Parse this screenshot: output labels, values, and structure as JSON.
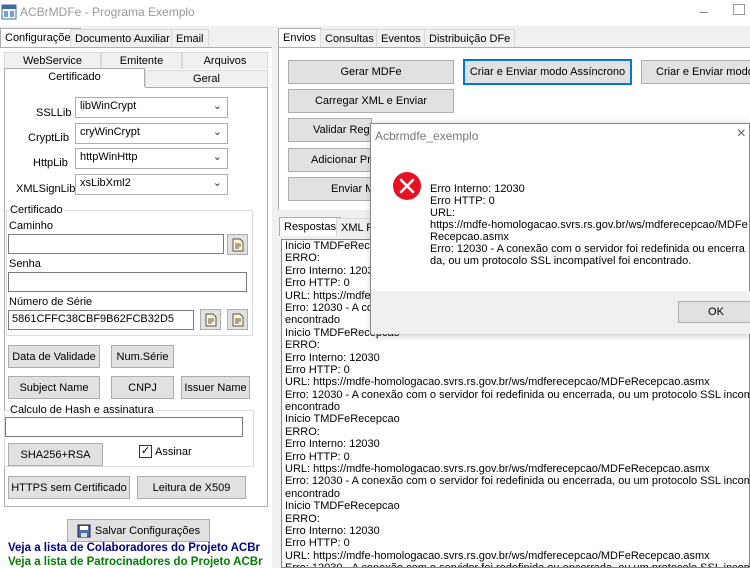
{
  "window": {
    "title": "ACBrMDFe - Programa Exemplo"
  },
  "left_tabs": [
    "Configurações",
    "Documento Auxiliar",
    "Email"
  ],
  "config_tabs_row1": [
    "WebService",
    "Emitente",
    "Arquivos"
  ],
  "config_tabs_row2": [
    "Certificado",
    "Geral"
  ],
  "libs": [
    {
      "label": "SSLLib",
      "value": "libWinCrypt"
    },
    {
      "label": "CryptLib",
      "value": "cryWinCrypt"
    },
    {
      "label": "HttpLib",
      "value": "httpWinHttp"
    },
    {
      "label": "XMLSignLib",
      "value": "xsLibXml2"
    }
  ],
  "certificado": {
    "group_title": "Certificado",
    "caminho_label": "Caminho",
    "caminho_value": "",
    "senha_label": "Senha",
    "senha_value": "",
    "serie_label": "Número de Série",
    "serie_value": "5861CFFC38CBF9B62FCB32D5"
  },
  "buttons": {
    "data_validade": "Data de Validade",
    "num_serie": "Num.Série",
    "subject_name": "Subject Name",
    "cnpj": "CNPJ",
    "issuer_name": "Issuer Name",
    "sha256": "SHA256+RSA",
    "https_sem_cert": "HTTPS sem Certificado",
    "leitura_x509": "Leitura de X509",
    "salvar": "Salvar Configurações"
  },
  "hash": {
    "group_title": "Calculo de Hash e assinatura",
    "value": "",
    "assinar_label": "Assinar",
    "assinar_checked": "✓"
  },
  "links": {
    "colaboradores": "Veja a lista de Colaboradores do Projeto ACBr",
    "patrocinadores": "Veja a lista de Patrocinadores do Projeto ACBr"
  },
  "right_tabs": [
    "Envios",
    "Consultas",
    "Eventos",
    "Distribuição DFe"
  ],
  "envios_buttons": {
    "gerar": "Gerar MDFe",
    "criar_async": "Criar e Enviar modo Assíncrono",
    "criar_sync": "Criar e Enviar modo S",
    "carregar": "Carregar XML e Enviar",
    "validar": "Validar Regra",
    "adicionar": "Adicionar Pro",
    "enviar": "Enviar M"
  },
  "bottom_tabs": [
    "Respostas",
    "XML R"
  ],
  "memo_lines": [
    "Inicio TMDFeRecepcao",
    "ERRO:",
    "Erro Interno: 12030",
    "Erro HTTP: 0",
    "URL: https://mdfe-",
    "Erro: 12030 - A conex",
    "encontrado",
    "Inicio TMDFeRecepcao",
    "ERRO:",
    "Erro Interno: 12030",
    "Erro HTTP: 0",
    "URL: https://mdfe-homologacao.svrs.rs.gov.br/ws/mdferecepcao/MDFeRecepcao.asmx",
    "Erro: 12030 - A conexão com o servidor foi redefinida ou encerrada, ou um protocolo SSL incompatíve",
    "encontrado",
    "Inicio TMDFeRecepcao",
    "ERRO:",
    "Erro Interno: 12030",
    "Erro HTTP: 0",
    "URL: https://mdfe-homologacao.svrs.rs.gov.br/ws/mdferecepcao/MDFeRecepcao.asmx",
    "Erro: 12030 - A conexão com o servidor foi redefinida ou encerrada, ou um protocolo SSL incompatíve",
    "encontrado",
    "Inicio TMDFeRecepcao",
    "ERRO:",
    "Erro Interno: 12030",
    "Erro HTTP: 0",
    "URL: https://mdfe-homologacao.svrs.rs.gov.br/ws/mdferecepcao/MDFeRecepcao.asmx",
    "Erro: 12030 - A conexão com o servidor foi redefinida ou encerrada, ou um protocolo SSL incompatíve"
  ],
  "dialog": {
    "title": "Acbrmdfe_exemplo",
    "message": "Erro Interno: 12030\nErro HTTP: 0\nURL:\nhttps://mdfe-homologacao.svrs.rs.gov.br/ws/mdferecepcao/MDFeRecepcao.asmx\nErro: 12030 - A conexão com o servidor foi redefinida ou encerrada, ou um protocolo SSL incompatível foi encontrado.",
    "ok_label": "OK",
    "icon": "error-icon"
  },
  "colors": {
    "accent": "#0078d7",
    "error": "#e81123",
    "link_blue": "#00008b",
    "link_green": "#008000"
  }
}
